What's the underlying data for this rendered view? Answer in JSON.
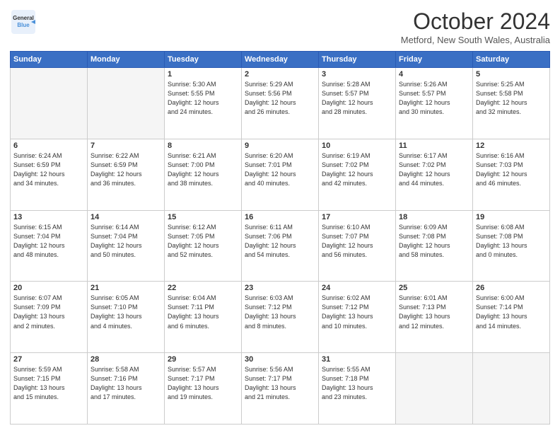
{
  "logo": {
    "line1": "General",
    "line2": "Blue",
    "icon": "▶"
  },
  "title": "October 2024",
  "location": "Metford, New South Wales, Australia",
  "days_of_week": [
    "Sunday",
    "Monday",
    "Tuesday",
    "Wednesday",
    "Thursday",
    "Friday",
    "Saturday"
  ],
  "weeks": [
    [
      {
        "day": "",
        "info": ""
      },
      {
        "day": "",
        "info": ""
      },
      {
        "day": "1",
        "info": "Sunrise: 5:30 AM\nSunset: 5:55 PM\nDaylight: 12 hours\nand 24 minutes."
      },
      {
        "day": "2",
        "info": "Sunrise: 5:29 AM\nSunset: 5:56 PM\nDaylight: 12 hours\nand 26 minutes."
      },
      {
        "day": "3",
        "info": "Sunrise: 5:28 AM\nSunset: 5:57 PM\nDaylight: 12 hours\nand 28 minutes."
      },
      {
        "day": "4",
        "info": "Sunrise: 5:26 AM\nSunset: 5:57 PM\nDaylight: 12 hours\nand 30 minutes."
      },
      {
        "day": "5",
        "info": "Sunrise: 5:25 AM\nSunset: 5:58 PM\nDaylight: 12 hours\nand 32 minutes."
      }
    ],
    [
      {
        "day": "6",
        "info": "Sunrise: 6:24 AM\nSunset: 6:59 PM\nDaylight: 12 hours\nand 34 minutes."
      },
      {
        "day": "7",
        "info": "Sunrise: 6:22 AM\nSunset: 6:59 PM\nDaylight: 12 hours\nand 36 minutes."
      },
      {
        "day": "8",
        "info": "Sunrise: 6:21 AM\nSunset: 7:00 PM\nDaylight: 12 hours\nand 38 minutes."
      },
      {
        "day": "9",
        "info": "Sunrise: 6:20 AM\nSunset: 7:01 PM\nDaylight: 12 hours\nand 40 minutes."
      },
      {
        "day": "10",
        "info": "Sunrise: 6:19 AM\nSunset: 7:02 PM\nDaylight: 12 hours\nand 42 minutes."
      },
      {
        "day": "11",
        "info": "Sunrise: 6:17 AM\nSunset: 7:02 PM\nDaylight: 12 hours\nand 44 minutes."
      },
      {
        "day": "12",
        "info": "Sunrise: 6:16 AM\nSunset: 7:03 PM\nDaylight: 12 hours\nand 46 minutes."
      }
    ],
    [
      {
        "day": "13",
        "info": "Sunrise: 6:15 AM\nSunset: 7:04 PM\nDaylight: 12 hours\nand 48 minutes."
      },
      {
        "day": "14",
        "info": "Sunrise: 6:14 AM\nSunset: 7:04 PM\nDaylight: 12 hours\nand 50 minutes."
      },
      {
        "day": "15",
        "info": "Sunrise: 6:12 AM\nSunset: 7:05 PM\nDaylight: 12 hours\nand 52 minutes."
      },
      {
        "day": "16",
        "info": "Sunrise: 6:11 AM\nSunset: 7:06 PM\nDaylight: 12 hours\nand 54 minutes."
      },
      {
        "day": "17",
        "info": "Sunrise: 6:10 AM\nSunset: 7:07 PM\nDaylight: 12 hours\nand 56 minutes."
      },
      {
        "day": "18",
        "info": "Sunrise: 6:09 AM\nSunset: 7:08 PM\nDaylight: 12 hours\nand 58 minutes."
      },
      {
        "day": "19",
        "info": "Sunrise: 6:08 AM\nSunset: 7:08 PM\nDaylight: 13 hours\nand 0 minutes."
      }
    ],
    [
      {
        "day": "20",
        "info": "Sunrise: 6:07 AM\nSunset: 7:09 PM\nDaylight: 13 hours\nand 2 minutes."
      },
      {
        "day": "21",
        "info": "Sunrise: 6:05 AM\nSunset: 7:10 PM\nDaylight: 13 hours\nand 4 minutes."
      },
      {
        "day": "22",
        "info": "Sunrise: 6:04 AM\nSunset: 7:11 PM\nDaylight: 13 hours\nand 6 minutes."
      },
      {
        "day": "23",
        "info": "Sunrise: 6:03 AM\nSunset: 7:12 PM\nDaylight: 13 hours\nand 8 minutes."
      },
      {
        "day": "24",
        "info": "Sunrise: 6:02 AM\nSunset: 7:12 PM\nDaylight: 13 hours\nand 10 minutes."
      },
      {
        "day": "25",
        "info": "Sunrise: 6:01 AM\nSunset: 7:13 PM\nDaylight: 13 hours\nand 12 minutes."
      },
      {
        "day": "26",
        "info": "Sunrise: 6:00 AM\nSunset: 7:14 PM\nDaylight: 13 hours\nand 14 minutes."
      }
    ],
    [
      {
        "day": "27",
        "info": "Sunrise: 5:59 AM\nSunset: 7:15 PM\nDaylight: 13 hours\nand 15 minutes."
      },
      {
        "day": "28",
        "info": "Sunrise: 5:58 AM\nSunset: 7:16 PM\nDaylight: 13 hours\nand 17 minutes."
      },
      {
        "day": "29",
        "info": "Sunrise: 5:57 AM\nSunset: 7:17 PM\nDaylight: 13 hours\nand 19 minutes."
      },
      {
        "day": "30",
        "info": "Sunrise: 5:56 AM\nSunset: 7:17 PM\nDaylight: 13 hours\nand 21 minutes."
      },
      {
        "day": "31",
        "info": "Sunrise: 5:55 AM\nSunset: 7:18 PM\nDaylight: 13 hours\nand 23 minutes."
      },
      {
        "day": "",
        "info": ""
      },
      {
        "day": "",
        "info": ""
      }
    ]
  ]
}
